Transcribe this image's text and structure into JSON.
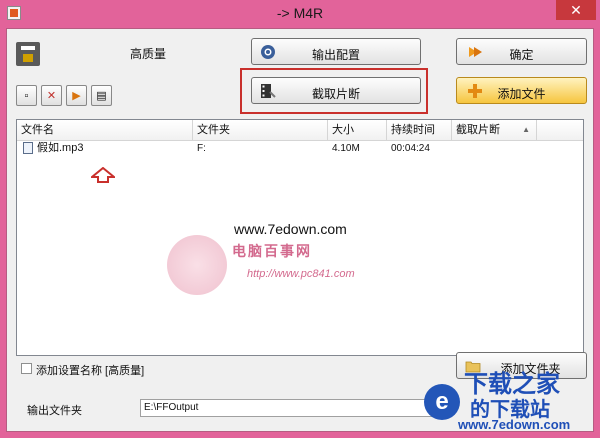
{
  "window": {
    "title": "-> M4R",
    "close_glyph": "✕"
  },
  "preset": {
    "label": "高质量"
  },
  "buttons": {
    "output_config": "输出配置",
    "ok": "确定",
    "clip": "截取片断",
    "add_file": "添加文件",
    "add_folder": "添加文件夹"
  },
  "toolbar": {
    "tools": [
      {
        "name": "remove-icon",
        "glyph": "▫"
      },
      {
        "name": "clear-icon",
        "glyph": "✕"
      },
      {
        "name": "play-icon",
        "glyph": "▶"
      },
      {
        "name": "info-icon",
        "glyph": "▤"
      }
    ]
  },
  "grid": {
    "columns": [
      "文件名",
      "文件夹",
      "大小",
      "持续时间",
      "截取片断"
    ],
    "sort_glyph": "▲",
    "rows": [
      {
        "name": "假如.mp3",
        "folder": "F:",
        "size": "4.10M",
        "duration": "00:04:24",
        "clip": ""
      }
    ]
  },
  "options": {
    "add_preset_name": "添加设置名称 [高质量]"
  },
  "output": {
    "label": "输出文件夹",
    "path": "E:\\FFOutput"
  },
  "watermarks": {
    "site": "www.7edown.com",
    "logo_title": "电脑百事网",
    "logo_url": "http://www.pc841.com",
    "brand_line1": "下载之家",
    "brand_line2": "的下载站",
    "brand_url": "www.7edown.com"
  },
  "colors": {
    "frame": "#e2639a",
    "highlight": "#c9302c",
    "arrow": "#c9302c",
    "brand": "#1f4fb7"
  }
}
